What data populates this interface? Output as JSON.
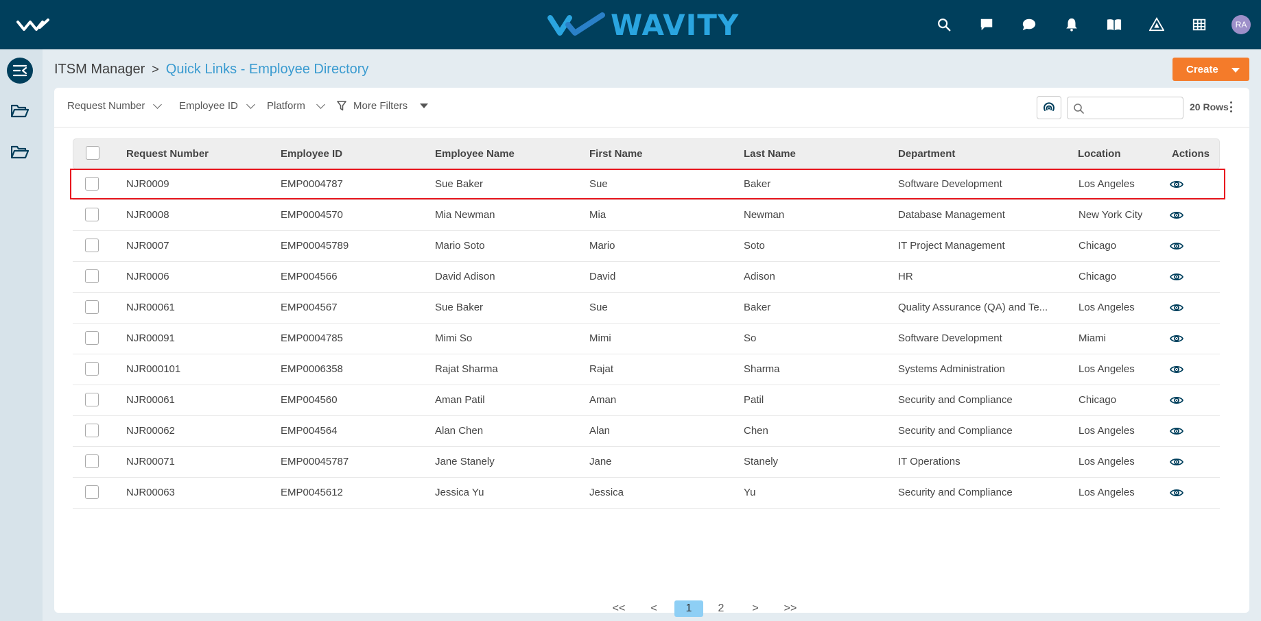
{
  "header": {
    "brand": "WAVITY",
    "icons": [
      "search-icon",
      "message-icon",
      "chat-icon",
      "bell-icon",
      "book-icon",
      "warning-icon",
      "grid-icon"
    ],
    "avatar_initials": "RA"
  },
  "breadcrumb": {
    "root": "ITSM Manager",
    "separator": ">",
    "current": "Quick Links - Employee Directory"
  },
  "toolbar": {
    "create_label": "Create",
    "filters": [
      "Request Number",
      "Employee ID",
      "Platform"
    ],
    "more_filters": "More Filters",
    "search_placeholder": "",
    "rows_label": "20 Rows"
  },
  "table": {
    "columns": [
      "Request Number",
      "Employee ID",
      "Employee Name",
      "First Name",
      "Last Name",
      "Department",
      "Location",
      "Actions"
    ],
    "rows": [
      [
        "NJR0009",
        "EMP0004787",
        "Sue Baker",
        "Sue",
        "Baker",
        "Software Development",
        "Los Angeles"
      ],
      [
        "NJR0008",
        "EMP0004570",
        "Mia Newman",
        "Mia",
        "Newman",
        "Database Management",
        "New York City"
      ],
      [
        "NJR0007",
        "EMP00045789",
        "Mario Soto",
        "Mario",
        "Soto",
        "IT Project Management",
        "Chicago"
      ],
      [
        "NJR0006",
        "EMP004566",
        "David Adison",
        "David",
        "Adison",
        "HR",
        "Chicago"
      ],
      [
        "NJR00061",
        "EMP004567",
        "Sue Baker",
        "Sue",
        "Baker",
        "Quality Assurance (QA) and Te...",
        "Los Angeles"
      ],
      [
        "NJR00091",
        "EMP0004785",
        "Mimi So",
        "Mimi",
        "So",
        "Software Development",
        "Miami"
      ],
      [
        "NJR000101",
        "EMP0006358",
        "Rajat Sharma",
        "Rajat",
        "Sharma",
        "Systems Administration",
        "Los Angeles"
      ],
      [
        "NJR00061",
        "EMP004560",
        "Aman Patil",
        "Aman",
        "Patil",
        "Security and Compliance",
        "Chicago"
      ],
      [
        "NJR00062",
        "EMP004564",
        "Alan Chen",
        "Alan",
        "Chen",
        "Security and Compliance",
        "Los Angeles"
      ],
      [
        "NJR00071",
        "EMP00045787",
        "Jane Stanely",
        "Jane",
        "Stanely",
        "IT Operations",
        "Los Angeles"
      ],
      [
        "NJR00063",
        "EMP0045612",
        "Jessica Yu",
        "Jessica",
        "Yu",
        "Security and Compliance",
        "Los Angeles"
      ]
    ]
  },
  "pagination": {
    "first": "<<",
    "prev": "<",
    "pages": [
      "1",
      "2"
    ],
    "current_page": "1",
    "next": ">",
    "last": ">>"
  },
  "colors": {
    "topbar": "#003f5c",
    "brand": "#2aa5e0",
    "accent": "#f47b2a",
    "link": "#3a9bd0",
    "highlight": "#e8161e"
  }
}
